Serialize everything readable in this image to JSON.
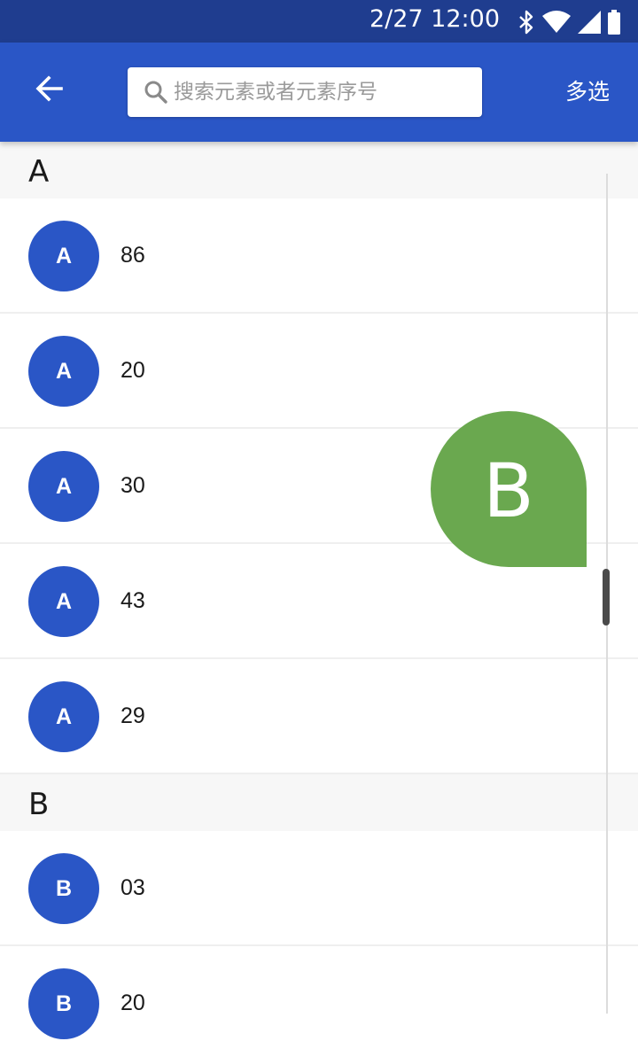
{
  "status_bar": {
    "time": "2/27 12:00",
    "icons": [
      "bluetooth-icon",
      "wifi-icon",
      "signal-icon",
      "battery-icon"
    ]
  },
  "app_bar": {
    "search_placeholder": "搜索元素或者元素序号",
    "multi_select_label": "多选",
    "background_color": "#2a56c6"
  },
  "sections": [
    {
      "letter": "A",
      "items": [
        {
          "avatar": "A",
          "label": "86"
        },
        {
          "avatar": "A",
          "label": "20"
        },
        {
          "avatar": "A",
          "label": "30"
        },
        {
          "avatar": "A",
          "label": "43"
        },
        {
          "avatar": "A",
          "label": "29"
        }
      ]
    },
    {
      "letter": "B",
      "items": [
        {
          "avatar": "B",
          "label": "03"
        },
        {
          "avatar": "B",
          "label": "20"
        }
      ]
    }
  ],
  "index_bubble": {
    "letter": "B",
    "color": "#6aa84f"
  }
}
